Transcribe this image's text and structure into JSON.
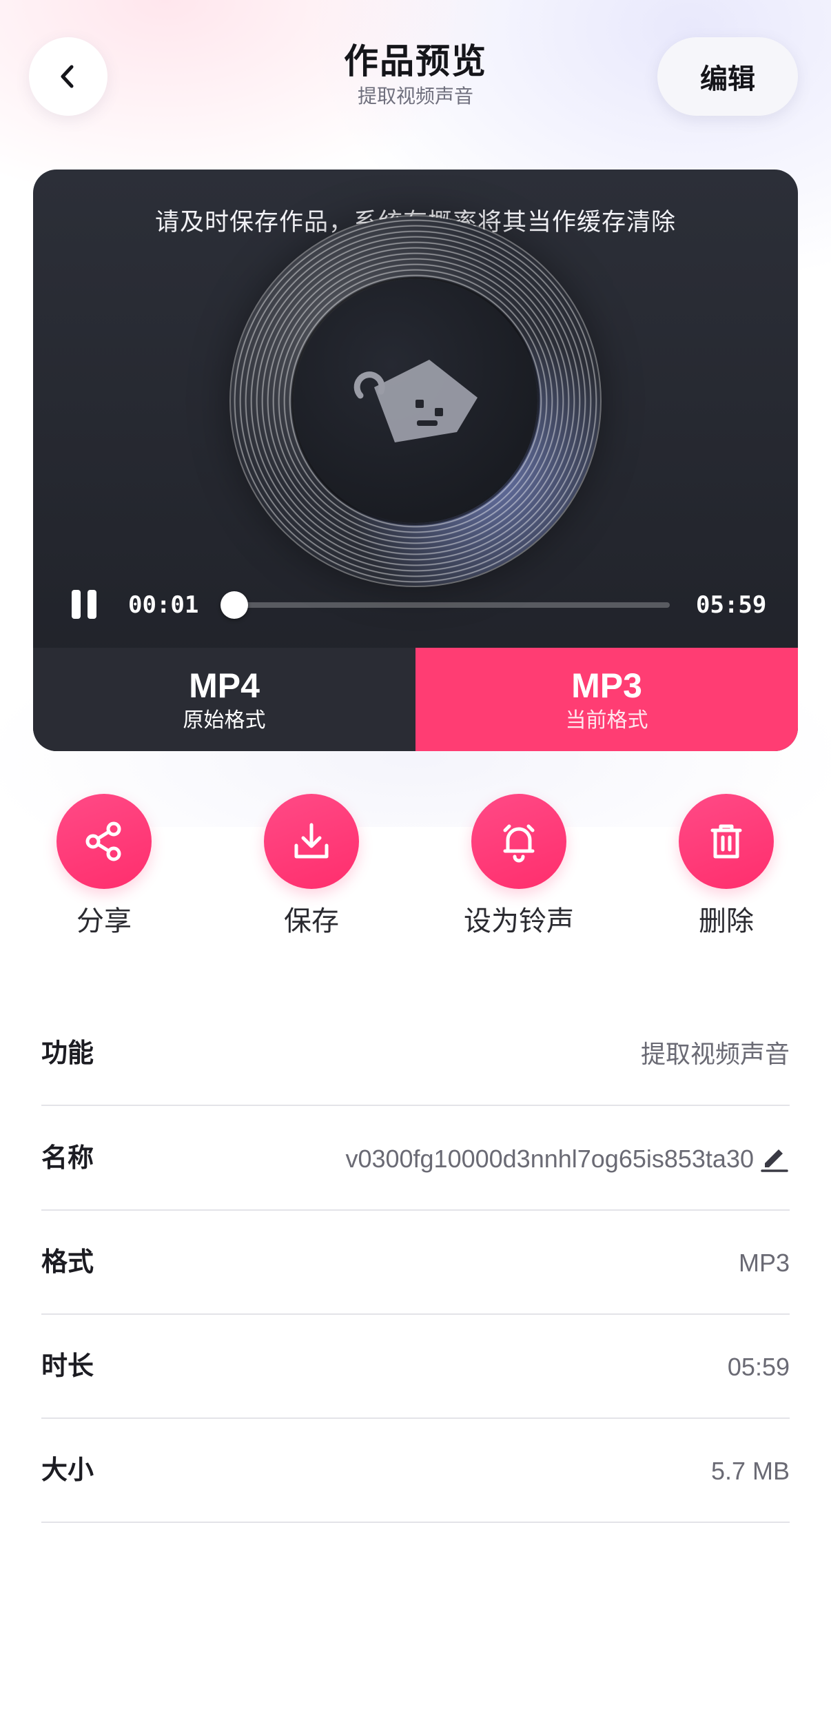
{
  "header": {
    "title": "作品预览",
    "subtitle": "提取视频声音",
    "back_icon": "chevron-left-icon",
    "edit_label": "编辑"
  },
  "player": {
    "notice": "请及时保存作品，系统有概率将其当作缓存清除",
    "current_time": "00:01",
    "total_time": "05:59",
    "progress": 0.003,
    "state": "playing",
    "formats": [
      {
        "name": "MP4",
        "desc": "原始格式"
      },
      {
        "name": "MP3",
        "desc": "当前格式"
      }
    ],
    "accent_color": "#ff3d73"
  },
  "actions": [
    {
      "label": "分享",
      "icon": "share-icon"
    },
    {
      "label": "保存",
      "icon": "download-icon"
    },
    {
      "label": "设为铃声",
      "icon": "bell-icon"
    },
    {
      "label": "删除",
      "icon": "trash-icon"
    }
  ],
  "info": [
    {
      "key": "功能",
      "value": "提取视频声音"
    },
    {
      "key": "名称",
      "value": "v0300fg10000d3nnhl7og65is853ta30"
    },
    {
      "key": "格式",
      "value": "MP3"
    },
    {
      "key": "时长",
      "value": "05:59"
    },
    {
      "key": "大小",
      "value": "5.7 MB"
    }
  ]
}
